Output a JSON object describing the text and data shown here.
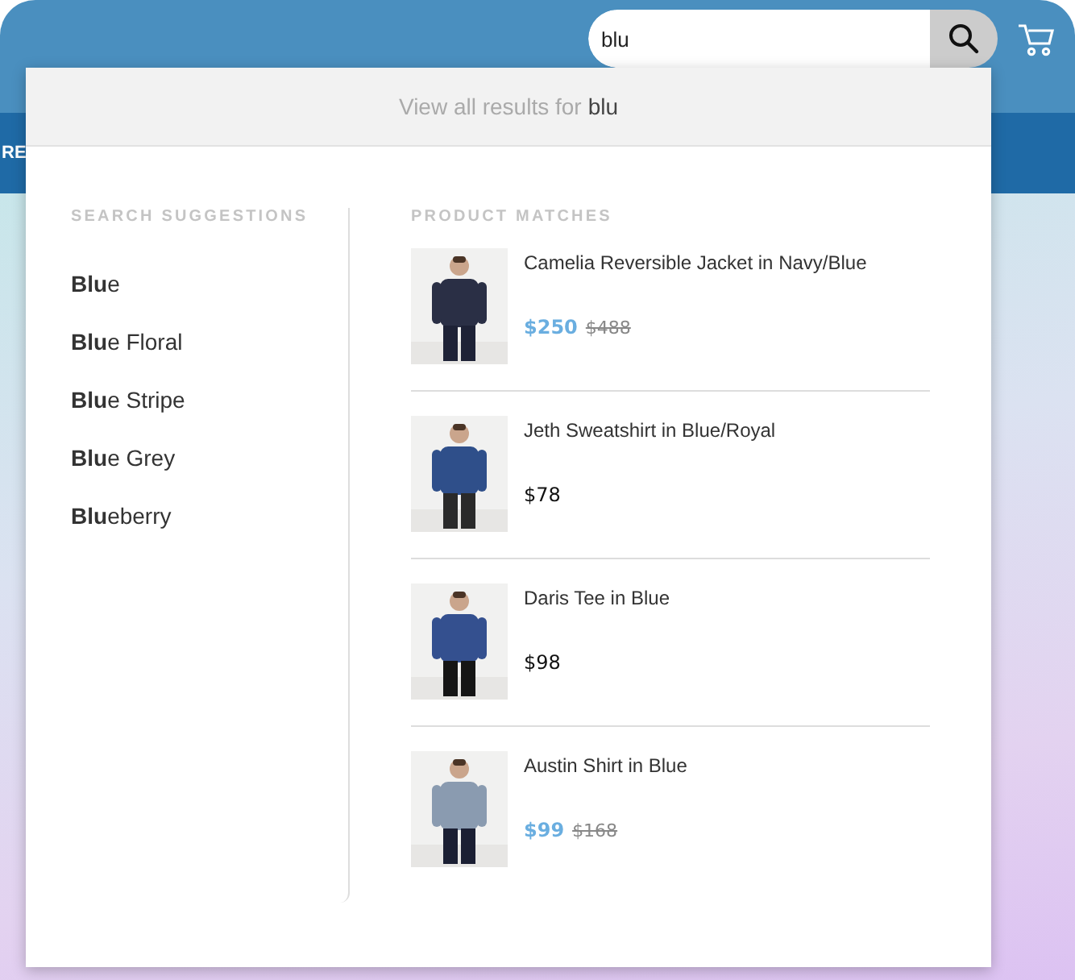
{
  "search": {
    "value": "blu"
  },
  "nav": {
    "label": "RE"
  },
  "dropdown": {
    "view_all": {
      "label": "View all results for",
      "query": "blu"
    },
    "suggestions": {
      "heading": "SEARCH SUGGESTIONS",
      "items": [
        "**Blu**e",
        "**Blu**e Floral",
        "**Blu**e Stripe",
        "**Blu**e Grey",
        "**Blu**eberry"
      ]
    },
    "products": {
      "heading": "PRODUCT MATCHES",
      "items": [
        {
          "name": "Camelia Reversible Jacket in Navy/Blue",
          "price": "$250",
          "compare_price": "$488",
          "on_sale": true
        },
        {
          "name": "Jeth Sweatshirt in Blue/Royal",
          "price": "$78",
          "on_sale": false
        },
        {
          "name": "Daris Tee in Blue",
          "price": "$98",
          "on_sale": false
        },
        {
          "name": "Austin Shirt in Blue",
          "price": "$99",
          "compare_price": "$168",
          "on_sale": true
        }
      ]
    }
  }
}
